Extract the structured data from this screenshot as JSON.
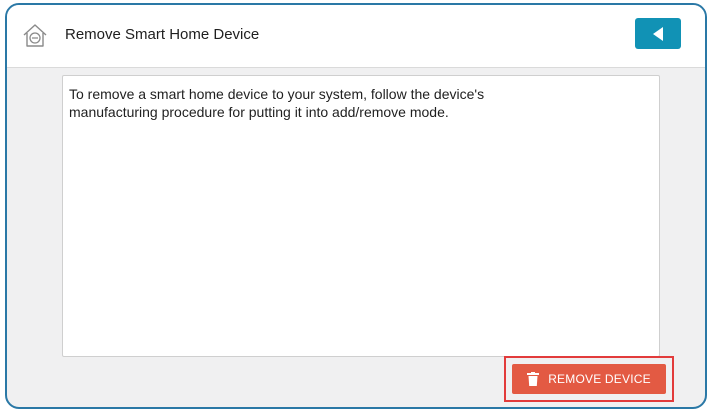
{
  "header": {
    "title": "Remove Smart Home Device",
    "home_icon": "home-minus-icon",
    "back_icon": "back-arrow-icon"
  },
  "content": {
    "message": "To remove a smart home device to your system, follow the device's manufacturing procedure for putting it into add/remove mode."
  },
  "actions": {
    "remove_label": "REMOVE DEVICE",
    "remove_icon": "trash-icon"
  },
  "colors": {
    "frame_border": "#2a78a6",
    "back_button": "#1192b5",
    "remove_button": "#e35a43",
    "highlight": "#e23b3b"
  }
}
